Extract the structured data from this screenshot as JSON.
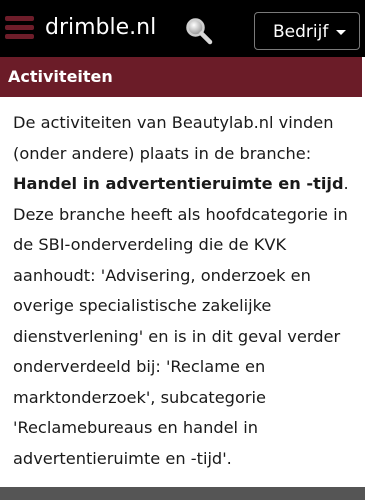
{
  "navbar": {
    "brand": "drimble.nl",
    "dropdown_label": "Bedrijf",
    "icons": [
      "menu-icon",
      "search-icon",
      "caret-down-icon"
    ]
  },
  "section": {
    "title": "Activiteiten"
  },
  "content": {
    "lines": [
      "De activiteiten van Beautylab.nl vinden",
      "(onder andere) plaats in de branche:",
      "Handel in advertentieruimte en -tijd",
      ".",
      "Deze branche heeft als hoofdcategorie in",
      "de SBI-onderverdeling die de KVK",
      "aanhoudt: 'Advisering, onderzoek en",
      "overige specialistische zakelijke",
      "dienstverlening' en is in dit geval verder",
      "onderverdeeld bij: 'Reclame en",
      "marktonderzoek', subcategorie",
      "'Reclamebureaus en handel in",
      "advertentieruimte en -tijd'."
    ]
  },
  "colors": {
    "navbar_bg": "#000000",
    "accent": "#6b1c28",
    "text": "#1a1a1a"
  }
}
